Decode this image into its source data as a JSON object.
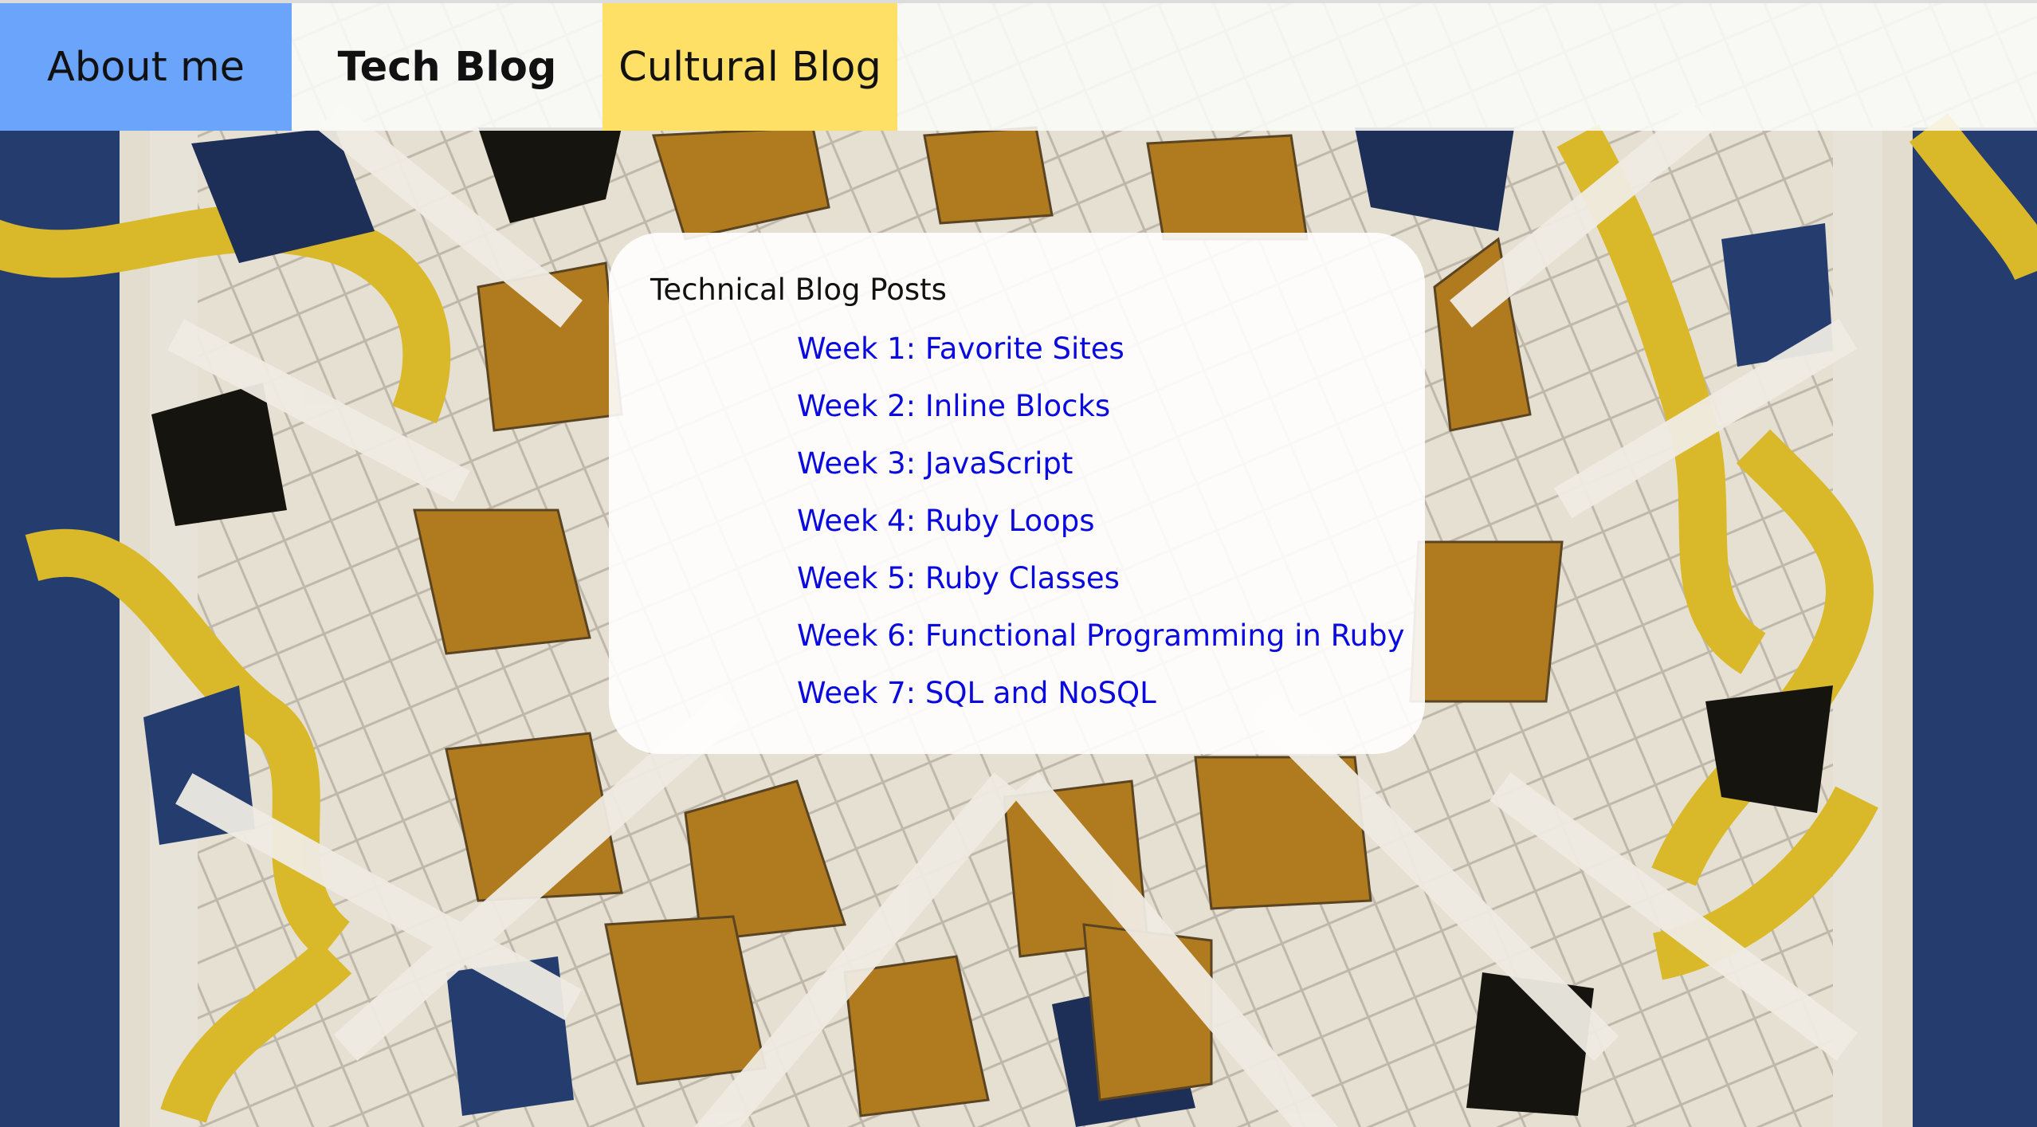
{
  "nav": {
    "about_label": "About me",
    "tech_label": "Tech Blog",
    "cultural_label": "Cultural Blog"
  },
  "panel": {
    "title": "Technical Blog Posts",
    "posts": [
      "Week 1: Favorite Sites",
      "Week 2: Inline Blocks",
      "Week 3: JavaScript",
      "Week 4: Ruby Loops",
      "Week 5: Ruby Classes",
      "Week 6: Functional Programming in Ruby",
      "Week 7: SQL and NoSQL"
    ]
  },
  "colors": {
    "about_bg": "#6aa5fb",
    "cultural_bg": "#ffe066",
    "link": "#0a0adf",
    "tile_white": "#e8e3d8",
    "tile_ochre": "#b07a1e",
    "tile_blue": "#243d6e",
    "tile_yellow": "#d9b92a",
    "tile_black": "#16140f"
  }
}
